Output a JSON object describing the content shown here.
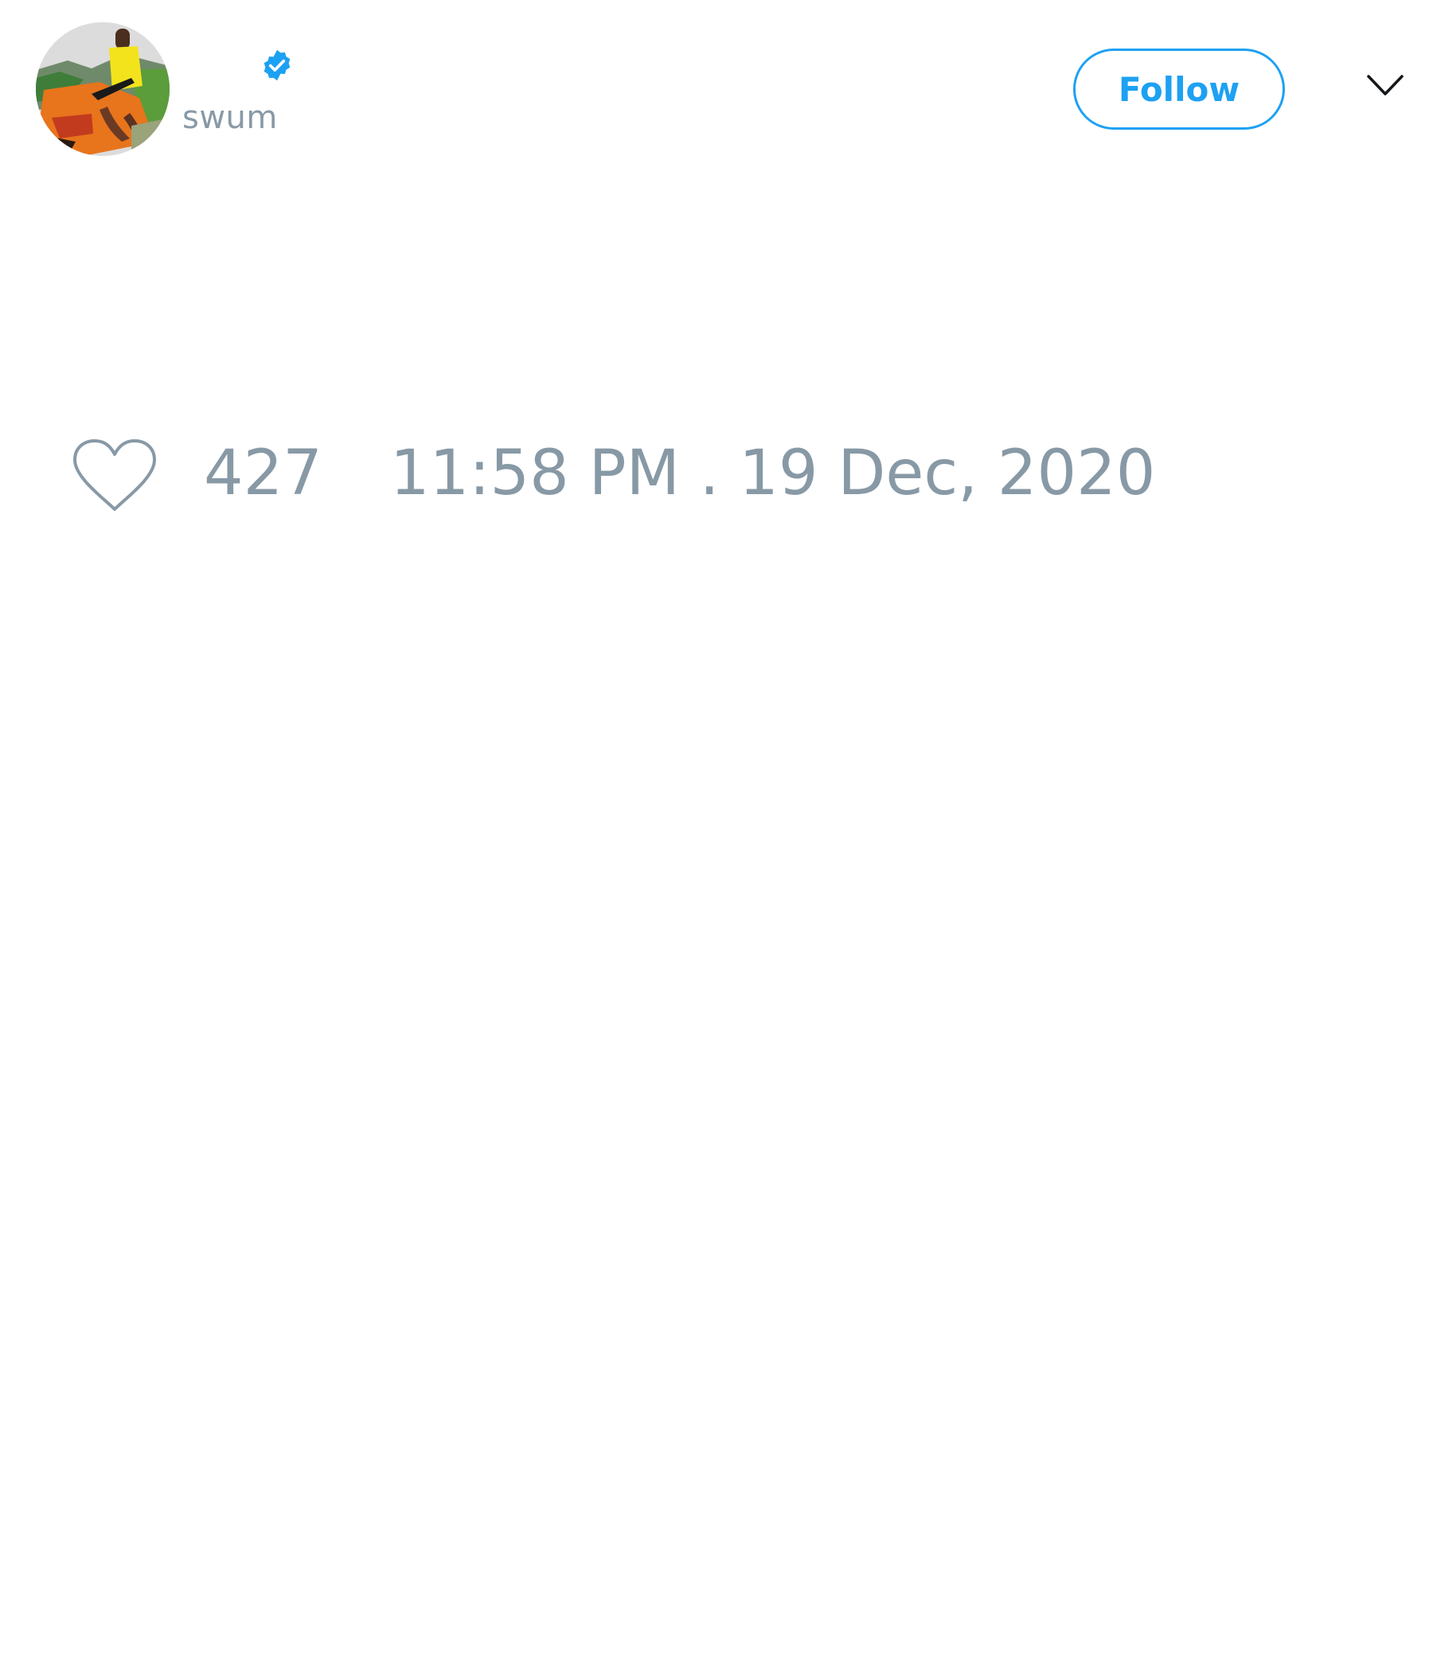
{
  "author": {
    "handle": "swum",
    "verified": true,
    "avatar_icon": "painting-avatar"
  },
  "header": {
    "follow_label": "Follow",
    "menu_icon": "chevron-down-icon"
  },
  "footer": {
    "like_icon": "heart-outline-icon",
    "like_count": "427",
    "timestamp": "11:58 PM . 19 Dec, 2020"
  },
  "colors": {
    "accent": "#1da1f2",
    "muted_text": "#8899a6",
    "background": "#ffffff"
  }
}
